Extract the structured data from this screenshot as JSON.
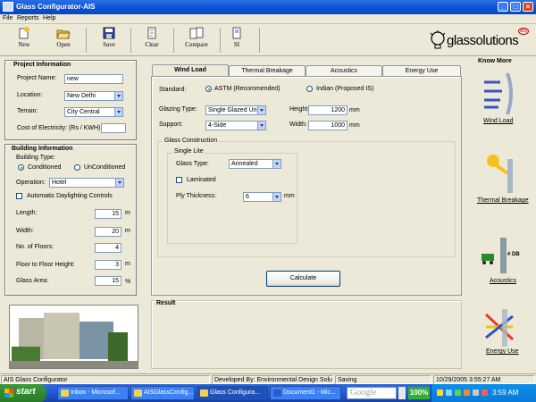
{
  "window": {
    "title": "Glass Configurator-AIS"
  },
  "menu": [
    "File",
    "Reports",
    "Help"
  ],
  "toolbar": [
    {
      "label": "New",
      "icon": "new-icon"
    },
    {
      "label": "Open",
      "icon": "open-folder-icon"
    },
    {
      "label": "Save",
      "icon": "save-disk-icon"
    },
    {
      "label": "Clear",
      "icon": "clear-icon"
    },
    {
      "label": "Compare",
      "icon": "compare-icon"
    },
    {
      "label": "SI",
      "icon": "si-document-icon"
    }
  ],
  "logo": {
    "text": "glassolutions",
    "badge": "AIS"
  },
  "project": {
    "title": "Project Information",
    "name_label": "Project Name:",
    "name_value": "new",
    "location_label": "Location:",
    "location_value": "New Delhi",
    "terrain_label": "Terrain:",
    "terrain_value": "City Central",
    "cost_label": "Cost of Electricity: (Rs / KWH)",
    "cost_value": ""
  },
  "building": {
    "title": "Building Information",
    "type_label": "Building Type:",
    "conditioned": "Conditioned",
    "unconditioned": "UnConditioned",
    "operation_label": "Operation:",
    "operation_value": "Hotel",
    "daylight_label": "Automatic Daylighting Controls",
    "length_label": "Length:",
    "length_value": "15",
    "length_unit": "m",
    "width_label": "Width:",
    "width_value": "20",
    "width_unit": "m",
    "floors_label": "No. of Floors:",
    "floors_value": "4",
    "height_label": "Floor to Floor Height:",
    "height_value": "3",
    "height_unit": "m",
    "glass_label": "Glass Area:",
    "glass_value": "15",
    "glass_unit": "%"
  },
  "tabs": [
    "Wind Load",
    "Thermal Breakage",
    "Acoustics",
    "Energy Use"
  ],
  "windload": {
    "standard_label": "Standard:",
    "astm": "ASTM (Recommended)",
    "indian": "Indian (Proposed IS)",
    "glazing_label": "Glazing Type:",
    "glazing_value": "Single Glazed Unit",
    "support_label": "Support:",
    "support_value": "4-Side",
    "height_label": "Height:",
    "height_value": "1200",
    "height_unit": "mm",
    "width_label": "Width:",
    "width_value": "1000",
    "width_unit": "mm",
    "construction_title": "Glass Construction",
    "single_lite": "Single Lite",
    "glass_type_label": "Glass Type:",
    "glass_type_value": "Annealed",
    "laminated_label": "Laminated",
    "ply_label": "Ply Thickness:",
    "ply_value": "6",
    "ply_unit": "mm",
    "calculate_label": "Calculate"
  },
  "result": {
    "title": "Result"
  },
  "knowmore": {
    "title": "Know More",
    "links": [
      "Wind Load",
      "Thermal Breakage",
      "Acoustics",
      "Energy Use"
    ],
    "db_text": "# DB"
  },
  "status": {
    "app": "AIS Glass Configurator",
    "developer": "Developed By: Environmental Design Solutions",
    "state": "Saving",
    "datetime": "10/29/2005 3:55:27 AM"
  },
  "taskbar": {
    "start": "start",
    "tasks": [
      "Inbox - Microsof...",
      "AISGlassConfig...",
      "Glass Configura...",
      "Document1 - Mic..."
    ],
    "google": "Google",
    "percent": "100%",
    "clock": "3:59 AM"
  }
}
